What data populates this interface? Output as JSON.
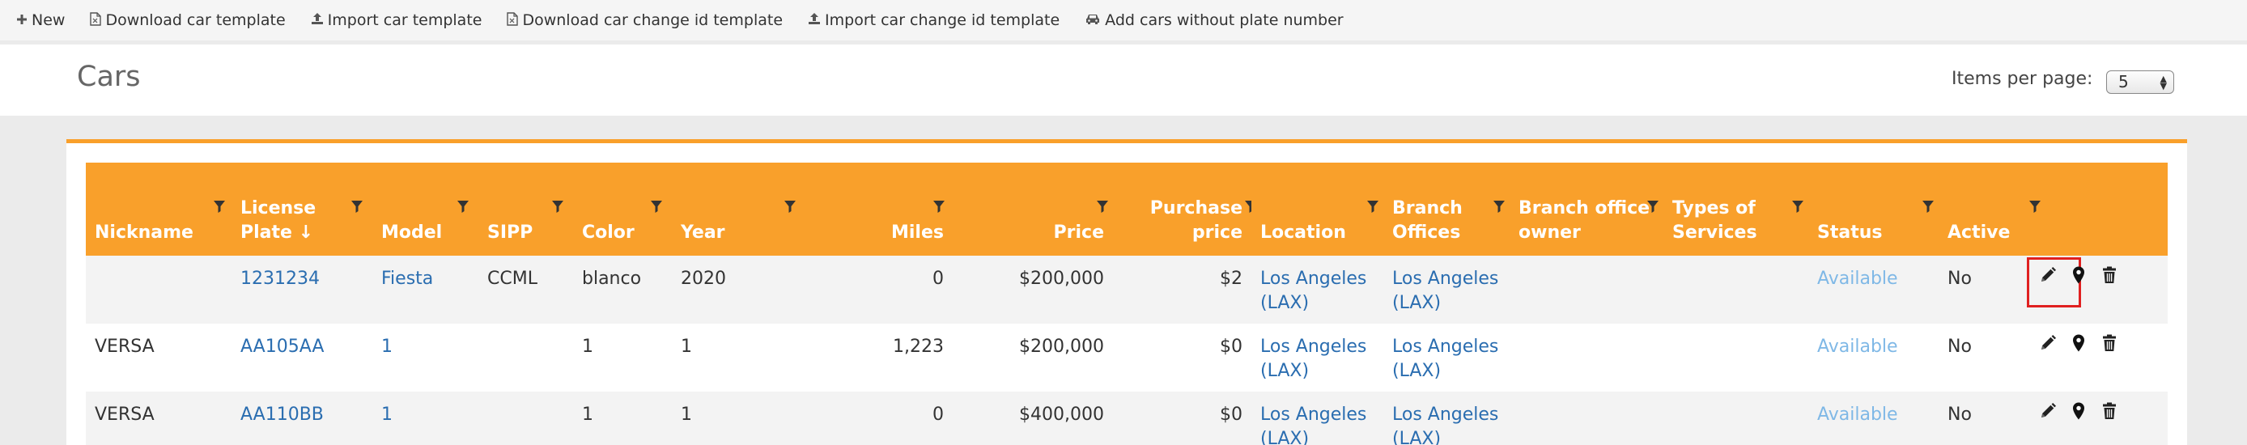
{
  "toolbar": {
    "items": [
      {
        "icon": "plus-icon",
        "label": "New"
      },
      {
        "icon": "document-icon",
        "label": "Download car template"
      },
      {
        "icon": "upload-icon",
        "label": "Import car template"
      },
      {
        "icon": "document-icon",
        "label": "Download car change id template"
      },
      {
        "icon": "upload-icon",
        "label": "Import car change id template"
      },
      {
        "icon": "car-icon",
        "label": "Add cars without plate number"
      }
    ]
  },
  "header": {
    "title": "Cars",
    "items_per_page_label": "Items per page:",
    "items_per_page_value": "5"
  },
  "table": {
    "columns": [
      {
        "label": "Nickname"
      },
      {
        "label": "License Plate ↓"
      },
      {
        "label": "Model"
      },
      {
        "label": "SIPP"
      },
      {
        "label": "Color"
      },
      {
        "label": "Year"
      },
      {
        "label": "Miles"
      },
      {
        "label": "Price"
      },
      {
        "label": "Purchase price"
      },
      {
        "label": "Location"
      },
      {
        "label": "Branch Offices"
      },
      {
        "label": "Branch office owner"
      },
      {
        "label": "Types of Services"
      },
      {
        "label": "Status"
      },
      {
        "label": "Active"
      },
      {
        "label": ""
      }
    ],
    "rows": [
      {
        "nickname": "",
        "plate": "1231234",
        "model": "Fiesta",
        "sipp": "CCML",
        "color": "blanco",
        "year": "2020",
        "miles": "0",
        "price": "$200,000",
        "purchase": "$2",
        "location": "Los Angeles (LAX)",
        "branch": "Los Angeles (LAX)",
        "owner": "",
        "services": "",
        "status": "Available",
        "active": "No"
      },
      {
        "nickname": "VERSA",
        "plate": "AA105AA",
        "model": "1",
        "sipp": "",
        "color": "1",
        "year": "1",
        "miles": "1,223",
        "price": "$200,000",
        "purchase": "$0",
        "location": "Los Angeles (LAX)",
        "branch": "Los Angeles (LAX)",
        "owner": "",
        "services": "",
        "status": "Available",
        "active": "No"
      },
      {
        "nickname": "VERSA",
        "plate": "AA110BB",
        "model": "1",
        "sipp": "",
        "color": "1",
        "year": "1",
        "miles": "0",
        "price": "$400,000",
        "purchase": "$0",
        "location": "Los Angeles (LAX)",
        "branch": "Los Angeles (LAX)",
        "owner": "",
        "services": "",
        "status": "Available",
        "active": "No"
      }
    ]
  },
  "colors": {
    "accent": "#f9a02b",
    "link": "#2a6db0",
    "status_available": "#7fb8e6",
    "highlight": "#e02020"
  }
}
